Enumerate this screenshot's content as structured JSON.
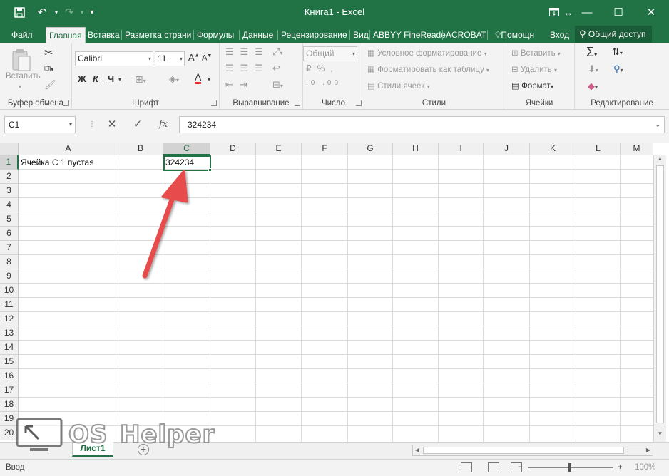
{
  "window": {
    "title": "Книга1 - Excel"
  },
  "ribbon_tabs": [
    {
      "label": "Файл"
    },
    {
      "label": "Главная"
    },
    {
      "label": "Вставка"
    },
    {
      "label": "Разметка страни"
    },
    {
      "label": "Формулы"
    },
    {
      "label": "Данные"
    },
    {
      "label": "Рецензирование"
    },
    {
      "label": "Вид"
    },
    {
      "label": "ABBYY FineReade"
    },
    {
      "label": "ACROBAT"
    },
    {
      "label": "Помощн"
    },
    {
      "label": "Вход"
    }
  ],
  "share_label": "Общий доступ",
  "clipboard": {
    "paste_label": "Вставить",
    "group_label": "Буфер обмена"
  },
  "font": {
    "name": "Calibri",
    "size": "11",
    "bold": "Ж",
    "italic": "К",
    "underline": "Ч",
    "group_label": "Шрифт"
  },
  "alignment": {
    "group_label": "Выравнивание"
  },
  "number": {
    "format": "Общий",
    "group_label": "Число"
  },
  "styles": {
    "conditional": "Условное форматирование",
    "table": "Форматировать как таблицу",
    "cell_styles": "Стили ячеек",
    "group_label": "Стили"
  },
  "cells": {
    "insert": "Вставить",
    "delete": "Удалить",
    "format": "Формат",
    "group_label": "Ячейки"
  },
  "editing": {
    "group_label": "Редактирование"
  },
  "formula_bar": {
    "name_box": "C1",
    "fx": "fx",
    "value": "324234"
  },
  "columns": [
    "A",
    "B",
    "C",
    "D",
    "E",
    "F",
    "G",
    "H",
    "I",
    "J",
    "K",
    "L",
    "M"
  ],
  "rows": [
    "1",
    "2",
    "3",
    "4",
    "5",
    "6",
    "7",
    "8",
    "9",
    "10",
    "11",
    "12",
    "13",
    "14",
    "15",
    "16",
    "17",
    "18",
    "19",
    "20"
  ],
  "cell_values": {
    "A1": "Ячейка С 1 пустая",
    "C1": "324234"
  },
  "sheet_tab": "Лист1",
  "status": "Ввод",
  "zoom": "100%",
  "watermark": {
    "text1": "OS",
    "text2": "Helper"
  },
  "colors": {
    "accent": "#217346",
    "arrow": "#e84c4c"
  }
}
